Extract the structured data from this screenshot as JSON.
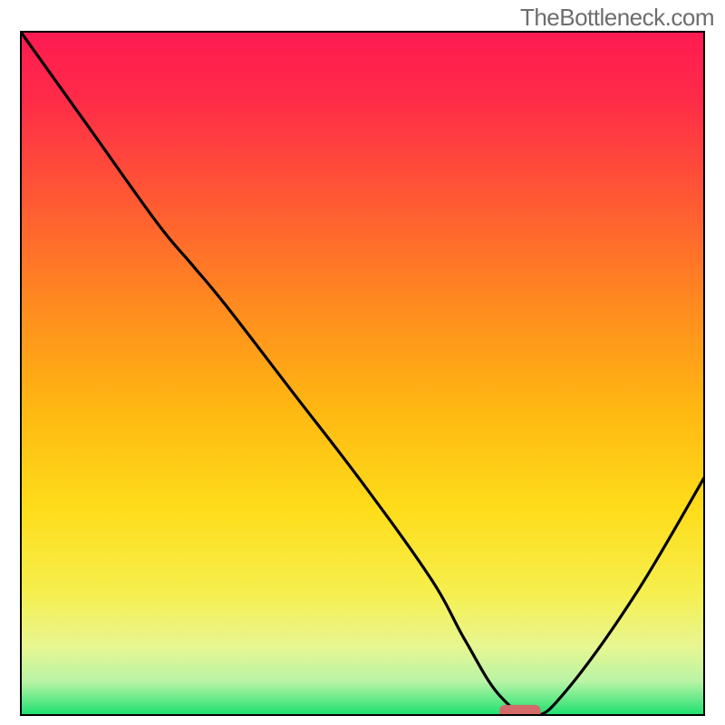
{
  "watermark": "TheBottleneck.com",
  "chart_data": {
    "type": "line",
    "title": "",
    "xlabel": "",
    "ylabel": "",
    "xlim": [
      0,
      100
    ],
    "ylim": [
      0,
      100
    ],
    "background": {
      "type": "vertical-gradient",
      "stops": [
        {
          "offset": 0.0,
          "color": "#ff1a52"
        },
        {
          "offset": 0.1,
          "color": "#ff2b48"
        },
        {
          "offset": 0.25,
          "color": "#ff5a33"
        },
        {
          "offset": 0.4,
          "color": "#ff8a1f"
        },
        {
          "offset": 0.55,
          "color": "#ffb712"
        },
        {
          "offset": 0.7,
          "color": "#fedd1a"
        },
        {
          "offset": 0.82,
          "color": "#f6ef4e"
        },
        {
          "offset": 0.9,
          "color": "#e7f692"
        },
        {
          "offset": 0.95,
          "color": "#b8f4a5"
        },
        {
          "offset": 1.0,
          "color": "#18e06e"
        }
      ]
    },
    "series": [
      {
        "name": "bottleneck-curve",
        "color": "#000000",
        "x": [
          0,
          10,
          20,
          25,
          30,
          40,
          50,
          60,
          65,
          70,
          75,
          80,
          90,
          100
        ],
        "y": [
          100,
          86,
          72,
          66,
          60,
          47,
          34,
          20,
          11,
          3,
          0,
          4,
          18,
          35
        ]
      }
    ],
    "marker": {
      "name": "optimal-point",
      "x": 73,
      "y": 0.6,
      "color": "#d46a6a",
      "width_pct": 6,
      "height_pct": 2
    },
    "border": {
      "color": "#000000",
      "width": 4
    }
  }
}
